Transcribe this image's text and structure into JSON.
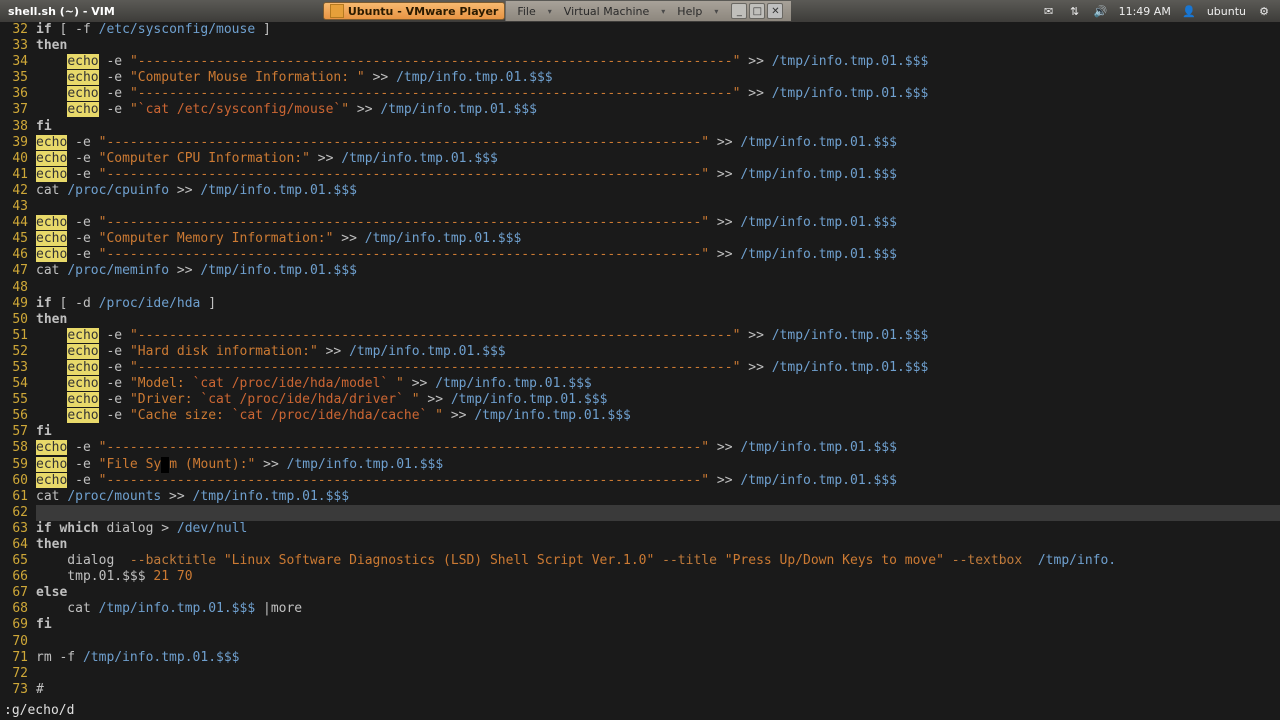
{
  "panel": {
    "window_title": "shell.sh (~) - VIM",
    "task_label": "Ubuntu - VMware Player",
    "vm_menu": [
      "File",
      "Virtual Machine",
      "Help"
    ],
    "time": "11:49 AM",
    "user": "ubuntu"
  },
  "editor": {
    "first_line": 32,
    "highlight_line": 62,
    "lines": [
      [
        [
          "kw",
          "if"
        ],
        [
          "id",
          " [ "
        ],
        [
          "op",
          "-f"
        ],
        [
          "id",
          " "
        ],
        [
          "path",
          "/etc/sysconfig/mouse"
        ],
        [
          "id",
          " ]"
        ]
      ],
      [
        [
          "kw",
          "then"
        ]
      ],
      [
        [
          "id",
          "    "
        ],
        [
          "match",
          "echo"
        ],
        [
          "id",
          " "
        ],
        [
          "op",
          "-e"
        ],
        [
          "id",
          " "
        ],
        [
          "str",
          "\"--------------------------------------------------------------------\""
        ],
        [
          "id",
          " >> "
        ],
        [
          "path",
          "/tmp/info.tmp.01.$$$"
        ]
      ],
      [
        [
          "id",
          "    "
        ],
        [
          "match",
          "echo"
        ],
        [
          "id",
          " "
        ],
        [
          "op",
          "-e"
        ],
        [
          "id",
          " "
        ],
        [
          "str",
          "\"Computer Mouse Information: \""
        ],
        [
          "id",
          " >> "
        ],
        [
          "path",
          "/tmp/info.tmp.01.$$$"
        ]
      ],
      [
        [
          "id",
          "    "
        ],
        [
          "match",
          "echo"
        ],
        [
          "id",
          " "
        ],
        [
          "op",
          "-e"
        ],
        [
          "id",
          " "
        ],
        [
          "str",
          "\"--------------------------------------------------------------------\""
        ],
        [
          "id",
          " >> "
        ],
        [
          "path",
          "/tmp/info.tmp.01.$$$"
        ]
      ],
      [
        [
          "id",
          "    "
        ],
        [
          "match",
          "echo"
        ],
        [
          "id",
          " "
        ],
        [
          "op",
          "-e"
        ],
        [
          "id",
          " "
        ],
        [
          "str",
          "\""
        ],
        [
          "bt",
          "`cat /etc/sysconfig/mouse`"
        ],
        [
          "str",
          "\""
        ],
        [
          "id",
          " >> "
        ],
        [
          "path",
          "/tmp/info.tmp.01.$$$"
        ]
      ],
      [
        [
          "kw",
          "fi"
        ]
      ],
      [
        [
          "match",
          "echo"
        ],
        [
          "id",
          " "
        ],
        [
          "op",
          "-e"
        ],
        [
          "id",
          " "
        ],
        [
          "str",
          "\"--------------------------------------------------------------------\""
        ],
        [
          "id",
          " >> "
        ],
        [
          "path",
          "/tmp/info.tmp.01.$$$"
        ]
      ],
      [
        [
          "match",
          "echo"
        ],
        [
          "id",
          " "
        ],
        [
          "op",
          "-e"
        ],
        [
          "id",
          " "
        ],
        [
          "str",
          "\"Computer CPU Information:\""
        ],
        [
          "id",
          " >> "
        ],
        [
          "path",
          "/tmp/info.tmp.01.$$$"
        ]
      ],
      [
        [
          "match",
          "echo"
        ],
        [
          "id",
          " "
        ],
        [
          "op",
          "-e"
        ],
        [
          "id",
          " "
        ],
        [
          "str",
          "\"--------------------------------------------------------------------\""
        ],
        [
          "id",
          " >> "
        ],
        [
          "path",
          "/tmp/info.tmp.01.$$$"
        ]
      ],
      [
        [
          "id",
          "cat "
        ],
        [
          "path",
          "/proc/cpuinfo"
        ],
        [
          "id",
          " >> "
        ],
        [
          "path",
          "/tmp/info.tmp.01.$$$"
        ]
      ],
      [],
      [
        [
          "match",
          "echo"
        ],
        [
          "id",
          " "
        ],
        [
          "op",
          "-e"
        ],
        [
          "id",
          " "
        ],
        [
          "str",
          "\"--------------------------------------------------------------------\""
        ],
        [
          "id",
          " >> "
        ],
        [
          "path",
          "/tmp/info.tmp.01.$$$"
        ]
      ],
      [
        [
          "match",
          "echo"
        ],
        [
          "id",
          " "
        ],
        [
          "op",
          "-e"
        ],
        [
          "id",
          " "
        ],
        [
          "str",
          "\"Computer Memory Information:\""
        ],
        [
          "id",
          " >> "
        ],
        [
          "path",
          "/tmp/info.tmp.01.$$$"
        ]
      ],
      [
        [
          "match",
          "echo"
        ],
        [
          "id",
          " "
        ],
        [
          "op",
          "-e"
        ],
        [
          "id",
          " "
        ],
        [
          "str",
          "\"--------------------------------------------------------------------\""
        ],
        [
          "id",
          " >> "
        ],
        [
          "path",
          "/tmp/info.tmp.01.$$$"
        ]
      ],
      [
        [
          "id",
          "cat "
        ],
        [
          "path",
          "/proc/meminfo"
        ],
        [
          "id",
          " >> "
        ],
        [
          "path",
          "/tmp/info.tmp.01.$$$"
        ]
      ],
      [],
      [
        [
          "kw",
          "if"
        ],
        [
          "id",
          " [ "
        ],
        [
          "op",
          "-d"
        ],
        [
          "id",
          " "
        ],
        [
          "path",
          "/proc/ide/hda"
        ],
        [
          "id",
          " ]"
        ]
      ],
      [
        [
          "kw",
          "then"
        ]
      ],
      [
        [
          "id",
          "    "
        ],
        [
          "match",
          "echo"
        ],
        [
          "id",
          " "
        ],
        [
          "op",
          "-e"
        ],
        [
          "id",
          " "
        ],
        [
          "str",
          "\"--------------------------------------------------------------------\""
        ],
        [
          "id",
          " >> "
        ],
        [
          "path",
          "/tmp/info.tmp.01.$$$"
        ]
      ],
      [
        [
          "id",
          "    "
        ],
        [
          "match",
          "echo"
        ],
        [
          "id",
          " "
        ],
        [
          "op",
          "-e"
        ],
        [
          "id",
          " "
        ],
        [
          "str",
          "\"Hard disk information:\""
        ],
        [
          "id",
          " >> "
        ],
        [
          "path",
          "/tmp/info.tmp.01.$$$"
        ]
      ],
      [
        [
          "id",
          "    "
        ],
        [
          "match",
          "echo"
        ],
        [
          "id",
          " "
        ],
        [
          "op",
          "-e"
        ],
        [
          "id",
          " "
        ],
        [
          "str",
          "\"--------------------------------------------------------------------\""
        ],
        [
          "id",
          " >> "
        ],
        [
          "path",
          "/tmp/info.tmp.01.$$$"
        ]
      ],
      [
        [
          "id",
          "    "
        ],
        [
          "match",
          "echo"
        ],
        [
          "id",
          " "
        ],
        [
          "op",
          "-e"
        ],
        [
          "id",
          " "
        ],
        [
          "str",
          "\"Model: "
        ],
        [
          "bt",
          "`cat /proc/ide/hda/model`"
        ],
        [
          "str",
          " \""
        ],
        [
          "id",
          " >> "
        ],
        [
          "path",
          "/tmp/info.tmp.01.$$$"
        ]
      ],
      [
        [
          "id",
          "    "
        ],
        [
          "match",
          "echo"
        ],
        [
          "id",
          " "
        ],
        [
          "op",
          "-e"
        ],
        [
          "id",
          " "
        ],
        [
          "str",
          "\"Driver: "
        ],
        [
          "bt",
          "`cat /proc/ide/hda/driver`"
        ],
        [
          "str",
          " \""
        ],
        [
          "id",
          " >> "
        ],
        [
          "path",
          "/tmp/info.tmp.01.$$$"
        ]
      ],
      [
        [
          "id",
          "    "
        ],
        [
          "match",
          "echo"
        ],
        [
          "id",
          " "
        ],
        [
          "op",
          "-e"
        ],
        [
          "id",
          " "
        ],
        [
          "str",
          "\"Cache size: "
        ],
        [
          "bt",
          "`cat /proc/ide/hda/cache`"
        ],
        [
          "str",
          " \""
        ],
        [
          "id",
          " >> "
        ],
        [
          "path",
          "/tmp/info.tmp.01.$$$"
        ]
      ],
      [
        [
          "kw",
          "fi"
        ]
      ],
      [
        [
          "match",
          "echo"
        ],
        [
          "id",
          " "
        ],
        [
          "op",
          "-e"
        ],
        [
          "id",
          " "
        ],
        [
          "str",
          "\"--------------------------------------------------------------------\""
        ],
        [
          "id",
          " >> "
        ],
        [
          "path",
          "/tmp/info.tmp.01.$$$"
        ]
      ],
      [
        [
          "match",
          "echo"
        ],
        [
          "id",
          " "
        ],
        [
          "op",
          "-e"
        ],
        [
          "id",
          " "
        ],
        [
          "str",
          "\"File Sy"
        ],
        [
          "cursor",
          " "
        ],
        [
          "str",
          "m (Mount):\""
        ],
        [
          "id",
          " >> "
        ],
        [
          "path",
          "/tmp/info.tmp.01.$$$"
        ]
      ],
      [
        [
          "match",
          "echo"
        ],
        [
          "id",
          " "
        ],
        [
          "op",
          "-e"
        ],
        [
          "id",
          " "
        ],
        [
          "str",
          "\"--------------------------------------------------------------------\""
        ],
        [
          "id",
          " >> "
        ],
        [
          "path",
          "/tmp/info.tmp.01.$$$"
        ]
      ],
      [
        [
          "id",
          "cat "
        ],
        [
          "path",
          "/proc/mounts"
        ],
        [
          "id",
          " >> "
        ],
        [
          "path",
          "/tmp/info.tmp.01.$$$"
        ]
      ],
      [],
      [
        [
          "kw",
          "if"
        ],
        [
          "id",
          " "
        ],
        [
          "kw",
          "which"
        ],
        [
          "id",
          " dialog > "
        ],
        [
          "path",
          "/dev/null"
        ]
      ],
      [
        [
          "kw",
          "then"
        ]
      ],
      [
        [
          "id",
          "    dialog  "
        ],
        [
          "opt",
          "--backtitle"
        ],
        [
          "id",
          " "
        ],
        [
          "str",
          "\"Linux Software Diagnostics (LSD) Shell Script Ver.1.0\""
        ],
        [
          "id",
          " "
        ],
        [
          "opt",
          "--title"
        ],
        [
          "id",
          " "
        ],
        [
          "str",
          "\"Press Up/Down Keys to move\""
        ],
        [
          "id",
          " "
        ],
        [
          "opt",
          "--textbox"
        ],
        [
          "id",
          "  "
        ],
        [
          "path",
          "/tmp/info."
        ]
      ],
      [
        [
          "id",
          "    tmp.01.$$$ "
        ],
        [
          "str",
          "21 70"
        ]
      ],
      [
        [
          "kw",
          "else"
        ]
      ],
      [
        [
          "id",
          "    cat "
        ],
        [
          "path",
          "/tmp/info.tmp.01.$$$"
        ],
        [
          "id",
          " |more"
        ]
      ],
      [
        [
          "kw",
          "fi"
        ]
      ],
      [],
      [
        [
          "id",
          "rm "
        ],
        [
          "op",
          "-f"
        ],
        [
          "id",
          " "
        ],
        [
          "path",
          "/tmp/info.tmp.01.$$$"
        ]
      ],
      [],
      [
        [
          "id",
          "#"
        ]
      ]
    ]
  },
  "cmdline": ":g/echo/d"
}
